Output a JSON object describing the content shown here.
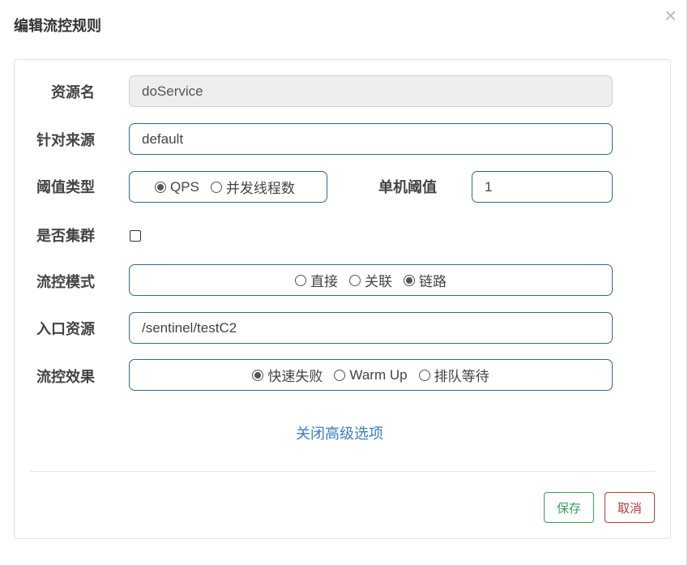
{
  "dialog": {
    "title": "编辑流控规则",
    "close_symbol": "×"
  },
  "form": {
    "resource_name_label": "资源名",
    "resource_name_value": "doService",
    "limit_app_label": "针对来源",
    "limit_app_value": "default",
    "threshold_type_label": "阈值类型",
    "threshold_type_options": [
      "QPS",
      "并发线程数"
    ],
    "threshold_type_selected": "QPS",
    "single_threshold_label": "单机阈值",
    "single_threshold_value": "1",
    "cluster_label": "是否集群",
    "cluster_checked": false,
    "strategy_label": "流控模式",
    "strategy_options": [
      "直接",
      "关联",
      "链路"
    ],
    "strategy_selected": "链路",
    "entry_resource_label": "入口资源",
    "entry_resource_value": "/sentinel/testC2",
    "effect_label": "流控效果",
    "effect_options": [
      "快速失败",
      "Warm Up",
      "排队等待"
    ],
    "effect_selected": "快速失败",
    "advanced_toggle": "关闭高级选项"
  },
  "footer": {
    "save_label": "保存",
    "cancel_label": "取消"
  },
  "colors": {
    "input_border": "#2b6c8a",
    "link": "#3a7fc1",
    "save": "#3c9c5b",
    "cancel": "#b93a3a"
  }
}
